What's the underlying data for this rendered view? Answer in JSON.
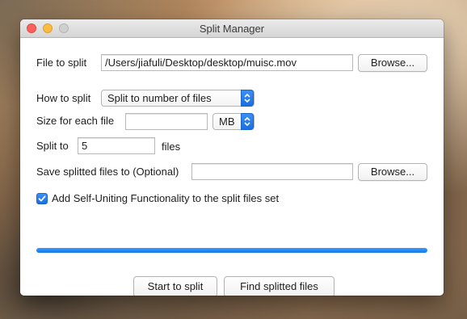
{
  "window": {
    "title": "Split Manager"
  },
  "form": {
    "file_to_split_label": "File to split",
    "file_path": "/Users/jiafuli/Desktop/desktop/muisc.mov",
    "browse_label": "Browse...",
    "how_to_split_label": "How to split",
    "how_to_split_value": "Split to number of files",
    "size_label": "Size for each file",
    "size_value": "",
    "size_unit": "MB",
    "split_to_label": "Split to",
    "split_to_value": "5",
    "split_to_suffix": "files",
    "save_label": "Save splitted files to (Optional)",
    "save_path": "",
    "save_browse_label": "Browse...",
    "checkbox_label": "Add Self-Uniting Functionality to the split files set",
    "checkbox_checked": true
  },
  "progress": {
    "value": 1.0
  },
  "actions": {
    "start_label": "Start to split",
    "find_label": "Find splitted files"
  },
  "colors": {
    "accent": "#1a6fe0",
    "close": "#fc605c",
    "minimize": "#fdbc40",
    "zoom": "#d0d0d0"
  }
}
